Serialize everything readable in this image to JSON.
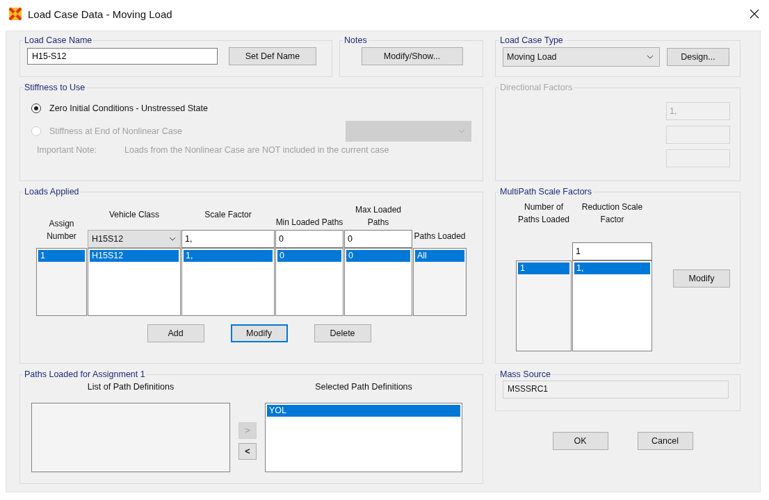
{
  "window": {
    "title": "Load Case Data - Moving Load"
  },
  "load_case_name": {
    "label": "Load Case Name",
    "value": "H15-S12",
    "button": "Set Def Name"
  },
  "notes": {
    "label": "Notes",
    "button": "Modify/Show..."
  },
  "load_case_type": {
    "label": "Load Case Type",
    "value": "Moving Load",
    "button": "Design..."
  },
  "stiffness": {
    "label": "Stiffness to Use",
    "options": [
      {
        "label": "Zero Initial Conditions - Unstressed State",
        "selected": true,
        "disabled": false
      },
      {
        "label": "Stiffness at End of Nonlinear Case",
        "selected": false,
        "disabled": true
      }
    ],
    "case_dropdown": {
      "disabled": true
    },
    "note_label": "Important Note:",
    "note": "Loads from the Nonlinear Case are NOT included in the current case"
  },
  "directional_factors": {
    "label": "Directional Factors",
    "disabled": true,
    "values": [
      "1,"
    ]
  },
  "loads_applied": {
    "label": "Loads Applied",
    "columns": [
      "Assign Number",
      "Vehicle Class",
      "Scale Factor",
      "Min Loaded Paths",
      "Max Loaded Paths",
      "Paths Loaded"
    ],
    "edit_row": {
      "vehicle_class": "H15S12",
      "scale_factor": "1,",
      "min_loaded_paths": "0",
      "max_loaded_paths": "0"
    },
    "rows": [
      {
        "cells": [
          "1",
          "H15S12",
          "1,",
          "0",
          "0",
          "All"
        ],
        "selected": true
      }
    ],
    "buttons": [
      {
        "label": "Add",
        "focused": false
      },
      {
        "label": "Modify",
        "focused": true
      },
      {
        "label": "Delete",
        "focused": false
      }
    ]
  },
  "multipath": {
    "label": "MultiPath Scale Factors",
    "columns": [
      "Number of Paths Loaded",
      "Reduction Scale Factor"
    ],
    "input": "1",
    "rows": [
      {
        "cells": [
          "1",
          "1,"
        ],
        "selected": true
      }
    ],
    "button": "Modify"
  },
  "paths_loaded": {
    "label": "Paths Loaded for Assignment 1",
    "available_label": "List of Path Definitions",
    "selected_label": "Selected Path Definitions",
    "selected_paths": [
      {
        "name": "YOL",
        "selected": true
      }
    ],
    "add_button": {
      "label": ">",
      "disabled": true
    },
    "remove_button": {
      "label": "<",
      "disabled": false
    }
  },
  "mass_source": {
    "label": "Mass Source",
    "value": "MSSSRC1"
  },
  "buttons": [
    "OK",
    "Cancel"
  ]
}
